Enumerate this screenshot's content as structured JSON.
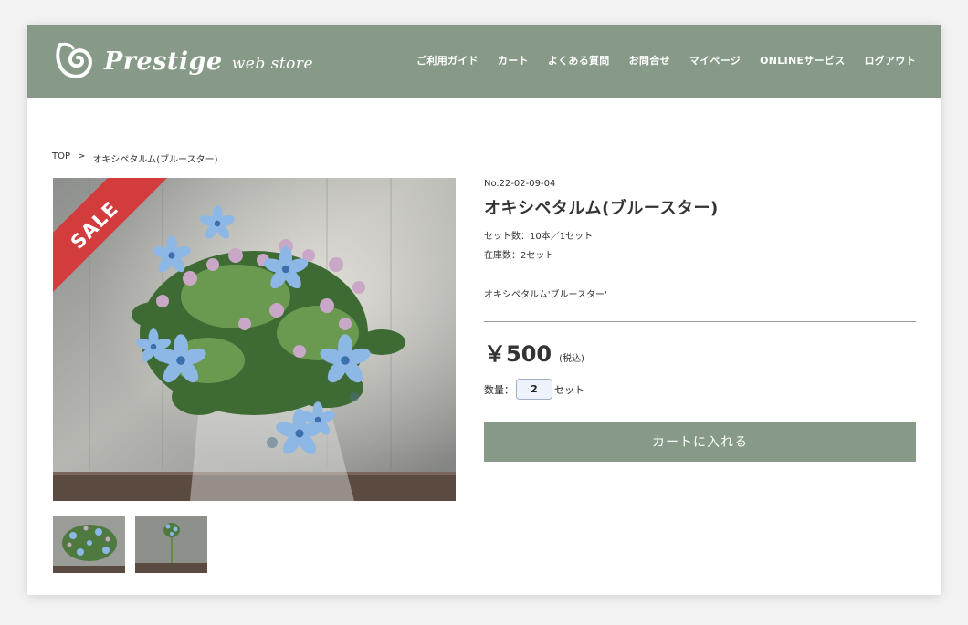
{
  "brand": {
    "name": "Prestige",
    "suffix": "web store",
    "logo_icon": "swirl-logo-icon"
  },
  "nav": [
    {
      "label": "ご利用ガイド"
    },
    {
      "label": "カート"
    },
    {
      "label": "よくある質問"
    },
    {
      "label": "お問合せ"
    },
    {
      "label": "マイページ"
    },
    {
      "label": "ONLINEサービス"
    },
    {
      "label": "ログアウト"
    }
  ],
  "breadcrumb": {
    "home": "TOP",
    "separator": ">",
    "current": "オキシペタルム(ブルースター)"
  },
  "gallery": {
    "badge": "SALE",
    "badge_color": "#d23c3c",
    "thumbnail_count": 2
  },
  "product": {
    "number": "No.22-02-09-04",
    "title": "オキシペタルム(ブルースター)",
    "set_count": "セット数：10本／1セット",
    "stock": "在庫数：2セット",
    "description": "オキシペタルム'ブルースター'",
    "price": "￥500",
    "tax_note": "(税込)",
    "quantity_label": "数量：",
    "quantity_value": "2",
    "quantity_unit": "セット",
    "add_to_cart": "カートに入れる"
  },
  "colors": {
    "accent": "#879a87",
    "sale": "#d23c3c"
  }
}
